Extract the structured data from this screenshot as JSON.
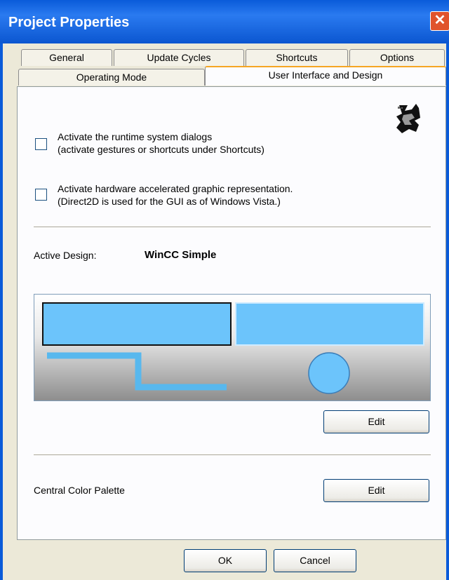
{
  "window": {
    "title": "Project Properties",
    "close_glyph": "✕"
  },
  "tabs": {
    "row1": [
      "General",
      "Update Cycles",
      "Shortcuts",
      "Options"
    ],
    "row2": [
      "Operating Mode",
      "User Interface and Design"
    ],
    "active": "User Interface and Design"
  },
  "options": {
    "runtime_dialogs": {
      "line1": "Activate the runtime system dialogs",
      "line2": "(activate gestures or shortcuts under Shortcuts)",
      "checked": false
    },
    "hw_accel": {
      "line1": "Activate hardware accelerated graphic representation.",
      "line2": "(Direct2D is used for the GUI as of Windows Vista.)",
      "checked": false
    }
  },
  "design": {
    "label": "Active Design:",
    "value": "WinCC Simple",
    "edit_label": "Edit"
  },
  "palette": {
    "label": "Central Color Palette",
    "edit_label": "Edit"
  },
  "footer": {
    "ok_label": "OK",
    "cancel_label": "Cancel"
  },
  "colors": {
    "titlebar": "#0A5BD9",
    "dialog_bg": "#ECE9D8",
    "accent_tab": "#F5A623",
    "preview_blue": "#6CC4FB"
  }
}
